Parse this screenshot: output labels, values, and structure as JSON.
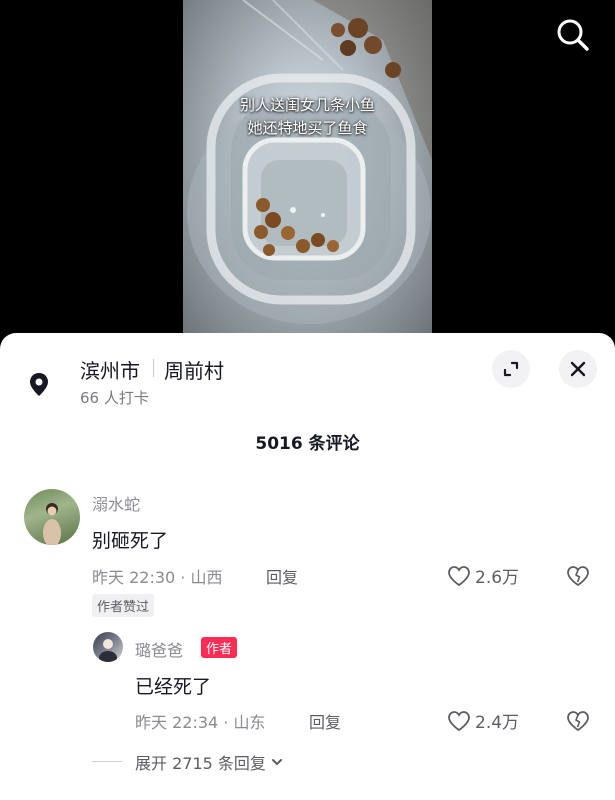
{
  "video": {
    "caption_line1": "别人送闺女几条小鱼",
    "caption_line2": "她还特地买了鱼食"
  },
  "icons": {
    "search": "search-icon",
    "location": "location-pin-icon",
    "expand": "expand-icon",
    "close": "close-icon",
    "like": "heart-outline-icon",
    "dislike": "broken-heart-icon",
    "chevron": "chevron-down-icon"
  },
  "location": {
    "city": "滨州市",
    "village": "周前村",
    "checkins": "66 人打卡"
  },
  "comments_header": {
    "count_label": "5016 条评论"
  },
  "comments": [
    {
      "username": "溺水蛇",
      "text": "别砸死了",
      "time_place": "昨天 22:30 · 山西",
      "reply_label": "回复",
      "likes": "2.6万",
      "badge": "作者赞过",
      "replies": [
        {
          "username": "璐爸爸",
          "author_tag": "作者",
          "text": "已经死了",
          "time_place": "昨天 22:34 · 山东",
          "reply_label": "回复",
          "likes": "2.4万"
        }
      ],
      "expand_replies_label": "展开 2715 条回复"
    }
  ],
  "colors": {
    "accent_red": "#fe2c55",
    "text_primary": "#161823",
    "text_secondary": "#8a8b91"
  }
}
